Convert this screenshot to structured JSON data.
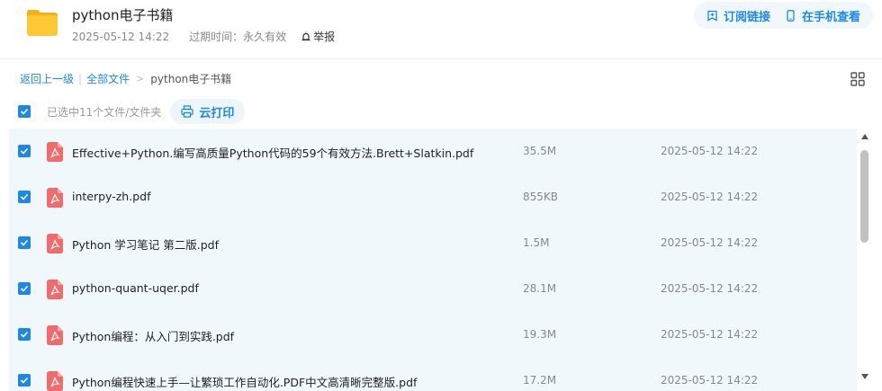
{
  "header": {
    "title": "python电子书籍",
    "created_time": "2025-05-12 14:22",
    "expire_label": "过期时间：",
    "expire_value": "永久有效",
    "report_label": "举报",
    "subscribe_label": "订阅链接",
    "mobile_label": "在手机查看",
    "accent_color": "#1e88e5",
    "folder_color": "#f9c21e"
  },
  "breadcrumb": {
    "back": "返回上一级",
    "separator": "|",
    "all_files": "全部文件",
    "arrow": ">",
    "current": "python电子书籍"
  },
  "selection": {
    "selected_text": "已选中11个文件/文件夹",
    "print_label": "云打印"
  },
  "files": [
    {
      "name": "Effective+Python.编写高质量Python代码的59个有效方法.Brett+Slatkin.pdf",
      "size": "35.5M",
      "date": "2025-05-12 14:22"
    },
    {
      "name": "interpy-zh.pdf",
      "size": "855KB",
      "date": "2025-05-12 14:22"
    },
    {
      "name": "Python 学习笔记 第二版.pdf",
      "size": "1.5M",
      "date": "2025-05-12 14:22"
    },
    {
      "name": "python-quant-uqer.pdf",
      "size": "28.1M",
      "date": "2025-05-12 14:22"
    },
    {
      "name": "Python编程：从入门到实践.pdf",
      "size": "19.3M",
      "date": "2025-05-12 14:22"
    },
    {
      "name": "Python编程快速上手—让繁琐工作自动化.PDF中文高清晰完整版.pdf",
      "size": "17.2M",
      "date": "2025-05-12 14:22"
    }
  ]
}
